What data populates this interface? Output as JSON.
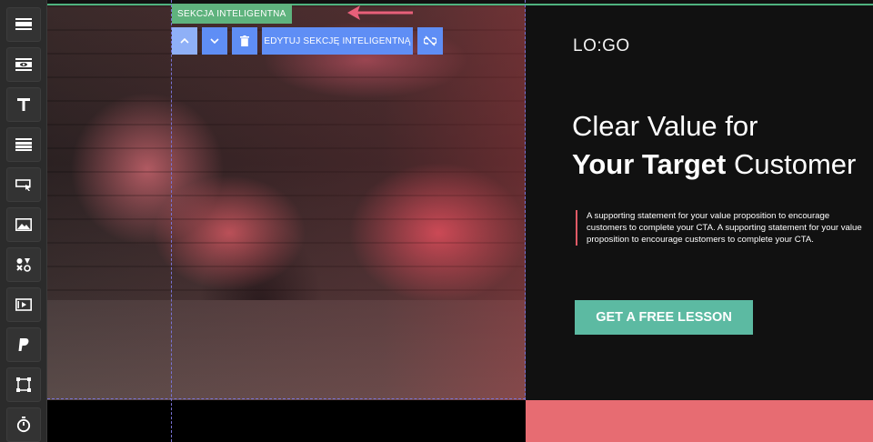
{
  "sidebar": {
    "tools": [
      {
        "name": "section-icon"
      },
      {
        "name": "hidden-section-icon"
      },
      {
        "name": "text-icon"
      },
      {
        "name": "rows-icon"
      },
      {
        "name": "button-icon"
      },
      {
        "name": "image-icon"
      },
      {
        "name": "shapes-icon"
      },
      {
        "name": "video-icon"
      },
      {
        "name": "paypal-icon"
      },
      {
        "name": "box-icon"
      },
      {
        "name": "timer-icon"
      }
    ]
  },
  "smart_section": {
    "tag_label": "SEKCJA INTELIGENTNA",
    "edit_label": "EDYTUJ SEKCJĘ INTELIGENTNĄ",
    "move_up_icon": "chevron-up-icon",
    "move_down_icon": "chevron-down-icon",
    "delete_icon": "trash-icon",
    "unlink_icon": "unlink-icon"
  },
  "hero": {
    "logo": "LO:GO",
    "headline_line1": "Clear Value for",
    "headline_bold": "Your Target",
    "headline_rest": "Customer",
    "supporting_text": "A supporting statement for your value proposition to encourage customers to complete your CTA. A supporting statement for your value proposition to encourage customers to complete your CTA.",
    "cta_label": "GET A FREE LESSON"
  },
  "colors": {
    "accent_green": "#5fb37e",
    "toolbar_blue": "#5f8ef5",
    "cta_teal": "#5cbaa2",
    "pink": "#e76c72",
    "arrow": "#e8607a"
  }
}
